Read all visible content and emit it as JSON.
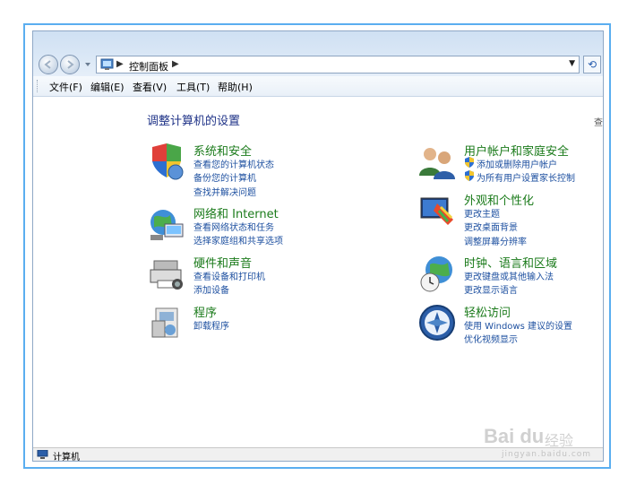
{
  "address_bar": {
    "crumb": "控制面板"
  },
  "menu": [
    "文件(F)",
    "编辑(E)",
    "查看(V)",
    "工具(T)",
    "帮助(H)"
  ],
  "page_title": "调整计算机的设置",
  "view_by_cut": "查",
  "categories_left": [
    {
      "title": "系统和安全",
      "icon": "system-security-icon",
      "links": [
        "查看您的计算机状态",
        "备份您的计算机",
        "查找并解决问题"
      ]
    },
    {
      "title": "网络和 Internet",
      "icon": "network-internet-icon",
      "links": [
        "查看网络状态和任务",
        "选择家庭组和共享选项"
      ]
    },
    {
      "title": "硬件和声音",
      "icon": "hardware-sound-icon",
      "links": [
        "查看设备和打印机",
        "添加设备"
      ]
    },
    {
      "title": "程序",
      "icon": "programs-icon",
      "links": [
        "卸载程序"
      ]
    }
  ],
  "categories_right": [
    {
      "title": "用户帐户和家庭安全",
      "icon": "user-accounts-icon",
      "links": [
        "添加或删除用户帐户",
        "为所有用户设置家长控制"
      ],
      "shield_links": true
    },
    {
      "title": "外观和个性化",
      "icon": "appearance-icon",
      "links": [
        "更改主题",
        "更改桌面背景",
        "调整屏幕分辨率"
      ]
    },
    {
      "title": "时钟、语言和区域",
      "icon": "clock-region-icon",
      "links": [
        "更改键盘或其他输入法",
        "更改显示语言"
      ]
    },
    {
      "title": "轻松访问",
      "icon": "ease-of-access-icon",
      "links": [
        "使用 Windows 建议的设置",
        "优化视频显示"
      ]
    }
  ],
  "status_bar": {
    "text": "计算机"
  },
  "watermark": {
    "brand": "Bai du",
    "suffix": "经验",
    "url": "jingyan.baidu.com"
  },
  "colors": {
    "title_green": "#1b7b1b",
    "link_blue": "#1e50a0",
    "page_title": "#1e3287",
    "frame": "#5aaef0"
  }
}
